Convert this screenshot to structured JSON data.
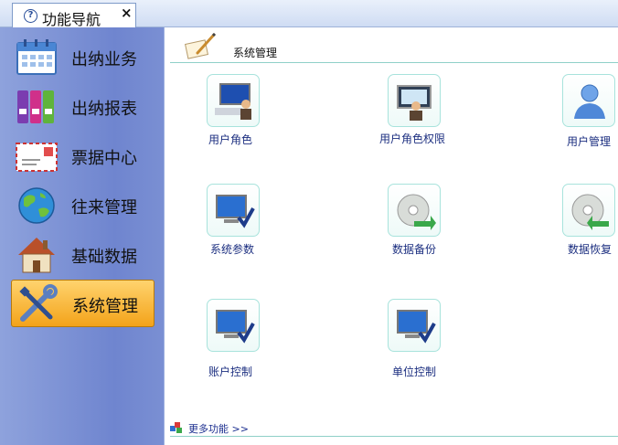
{
  "tab": {
    "label": "功能导航",
    "close": "×",
    "help_glyph": "?"
  },
  "sidebar": {
    "items": [
      {
        "label": "出纳业务",
        "icon": "calendar-icon",
        "active": false
      },
      {
        "label": "出纳报表",
        "icon": "binders-icon",
        "active": false
      },
      {
        "label": "票据中心",
        "icon": "envelope-stamp-icon",
        "active": false
      },
      {
        "label": "往来管理",
        "icon": "globe-icon",
        "active": false
      },
      {
        "label": "基础数据",
        "icon": "house-icon",
        "active": false
      },
      {
        "label": "系统管理",
        "icon": "tools-icon",
        "active": true
      }
    ]
  },
  "content": {
    "title": "系统管理",
    "functions": [
      {
        "label": "用户角色",
        "icon": "computer-user-icon"
      },
      {
        "label": "用户角色权限",
        "icon": "monitor-user-icon"
      },
      {
        "label": "用户管理",
        "icon": "user-avatar-icon"
      },
      {
        "label": "系统参数",
        "icon": "monitor-check-icon"
      },
      {
        "label": "数据备份",
        "icon": "disc-arrow-icon"
      },
      {
        "label": "数据恢复",
        "icon": "disc-restore-icon"
      },
      {
        "label": "账户控制",
        "icon": "monitor-check-icon"
      },
      {
        "label": "单位控制",
        "icon": "monitor-check-icon"
      }
    ],
    "more": "更多功能 >>"
  },
  "colors": {
    "sidebar": "#7b8fd4",
    "active": "#f7b531",
    "accent_line": "#8fd0c8",
    "link": "#1b2e8f"
  }
}
